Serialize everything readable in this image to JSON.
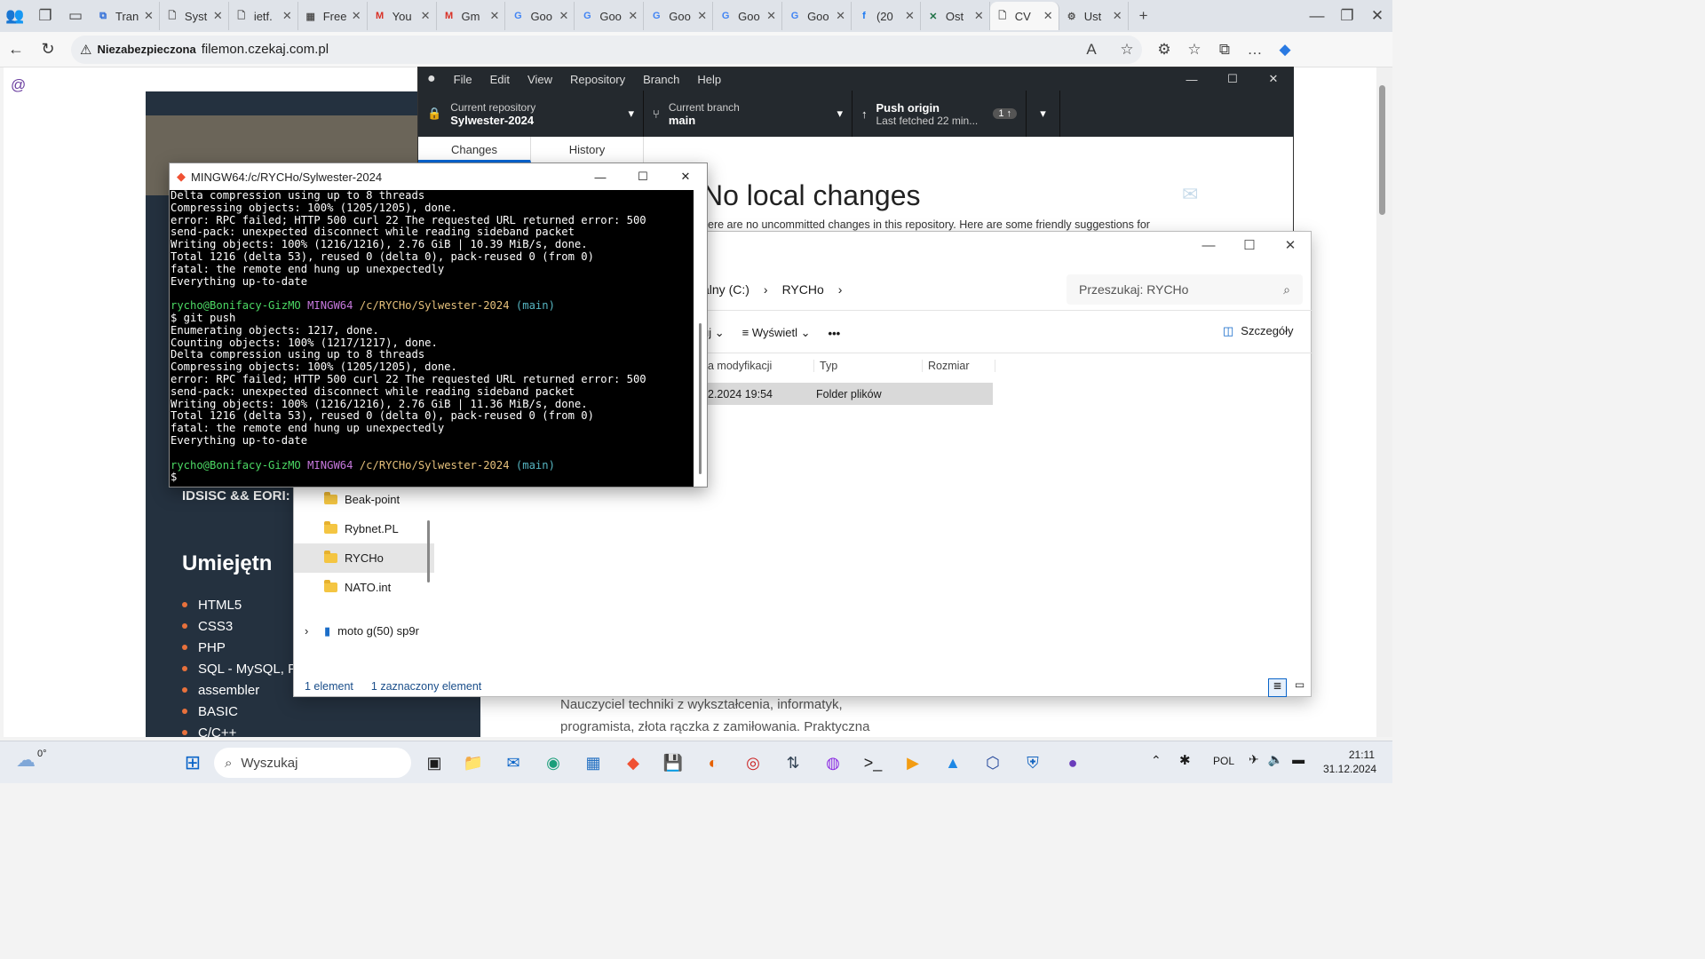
{
  "browser": {
    "tabs": [
      {
        "icon": "microsoft-icon",
        "label": "Tran",
        "active": false
      },
      {
        "icon": "document-icon",
        "label": "Syst",
        "active": false
      },
      {
        "icon": "document-icon",
        "label": "ietf.",
        "active": false
      },
      {
        "icon": "image-icon",
        "label": "Free",
        "active": false
      },
      {
        "icon": "gmail-icon",
        "label": "You",
        "active": false
      },
      {
        "icon": "gmail-icon",
        "label": "Gm",
        "active": false
      },
      {
        "icon": "google-icon",
        "label": "Goo",
        "active": false
      },
      {
        "icon": "google-icon",
        "label": "Goo",
        "active": false
      },
      {
        "icon": "google-icon",
        "label": "Goo",
        "active": false
      },
      {
        "icon": "google-icon",
        "label": "Goo",
        "active": false
      },
      {
        "icon": "google-icon",
        "label": "Goo",
        "active": false
      },
      {
        "icon": "facebook-icon",
        "label": "(20",
        "active": false
      },
      {
        "icon": "spreadsheet-icon",
        "label": "Ost",
        "active": false
      },
      {
        "icon": "document-icon",
        "label": "CV",
        "active": true
      },
      {
        "icon": "gear-icon",
        "label": "Ust",
        "active": false
      }
    ],
    "security_label": "Niezabezpieczona",
    "url": "filemon.czekaj.com.pl"
  },
  "cv": {
    "section_idsisc": "IDSISC && EORI:",
    "skills_heading": "Umiejętn",
    "skills": [
      "HTML5",
      "CSS3",
      "PHP",
      "SQL - MySQL, P",
      "assembler",
      "BASIC",
      "C/C++"
    ],
    "bio_line1": "Nauczyciel techniki z wykształcenia, informatyk,",
    "bio_line2": "programista, złota rączka z zamiłowania. Praktyczna"
  },
  "github": {
    "menu": [
      "File",
      "Edit",
      "View",
      "Repository",
      "Branch",
      "Help"
    ],
    "repo_label": "Current repository",
    "repo_name": "Sylwester-2024",
    "branch_label": "Current branch",
    "branch_name": "main",
    "push_label": "Push origin",
    "push_sub": "Last fetched 22 min...",
    "push_badge": "1 ↑",
    "tabs": [
      "Changes",
      "History"
    ],
    "heading": "No local changes",
    "subtext": "ere are no uncommitted changes in this repository. Here are some friendly suggestions for"
  },
  "terminal": {
    "title": "MINGW64:/c/RYCHo/Sylwester-2024",
    "prompt_user": "rycho@Bonifacy-GizMO",
    "prompt_env": "MINGW64",
    "prompt_path": "/c/RYCHo/Sylwester-2024",
    "prompt_branch": "(main)",
    "lines_a": [
      "Delta compression using up to 8 threads",
      "Compressing objects: 100% (1205/1205), done.",
      "error: RPC failed; HTTP 500 curl 22 The requested URL returned error: 500",
      "send-pack: unexpected disconnect while reading sideband packet",
      "Writing objects: 100% (1216/1216), 2.76 GiB | 10.39 MiB/s, done.",
      "Total 1216 (delta 53), reused 0 (delta 0), pack-reused 0 (from 0)",
      "fatal: the remote end hung up unexpectedly",
      "Everything up-to-date"
    ],
    "command": "$ git push",
    "lines_b": [
      "Enumerating objects: 1217, done.",
      "Counting objects: 100% (1217/1217), done.",
      "Delta compression using up to 8 threads",
      "Compressing objects: 100% (1205/1205), done.",
      "error: RPC failed; HTTP 500 curl 22 The requested URL returned error: 500",
      "send-pack: unexpected disconnect while reading sideband packet",
      "Writing objects: 100% (1216/1216), 2.76 GiB | 11.36 MiB/s, done.",
      "Total 1216 (delta 53), reused 0 (delta 0), pack-reused 0 (from 0)",
      "fatal: the remote end hung up unexpectedly",
      "Everything up-to-date"
    ],
    "last_prompt": "$"
  },
  "explorer": {
    "breadcrumb_drive": "alny (C:)",
    "breadcrumb_folder": "RYCHo",
    "search_placeholder": "Przeszukaj: RYCHo",
    "sort_label": "uj",
    "view_label": "Wyświetl",
    "more_label": "•••",
    "details_label": "Szczegóły",
    "columns": [
      "a modyfikacji",
      "Typ",
      "Rozmiar"
    ],
    "row": {
      "date": "2.2024 19:54",
      "type": "Folder plików",
      "size": ""
    },
    "nav_items": [
      "Beak-point",
      "Rybnet.PL",
      "RYCHo",
      "NATO.int"
    ],
    "device": "moto g(50) sp9r",
    "status_count": "1 element",
    "status_selected": "1 zaznaczony element"
  },
  "taskbar": {
    "weather": "0°",
    "search": "Wyszukaj",
    "lang": "POL",
    "time": "21:11",
    "date": "31.12.2024",
    "apps": [
      "file-explorer-icon",
      "outlook-icon",
      "edge-icon",
      "store-icon",
      "git-icon",
      "save-icon",
      "firefox-icon",
      "davinci-icon",
      "network-icon",
      "podcast-icon",
      "terminal-icon",
      "media-icon",
      "photos-icon",
      "virtualbox-icon",
      "shield-icon",
      "github-icon"
    ]
  }
}
